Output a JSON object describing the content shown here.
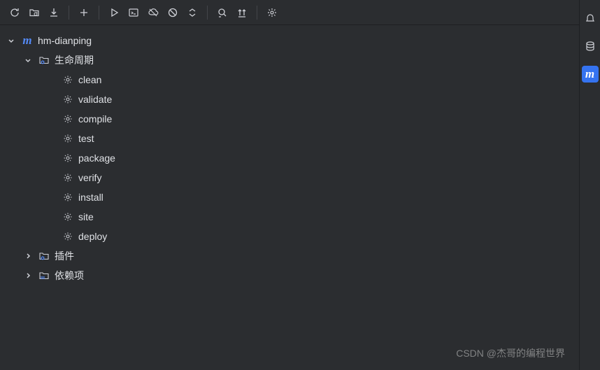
{
  "toolbar": {
    "icons": [
      "refresh",
      "add-maven",
      "download",
      "plus",
      "run",
      "run-config",
      "offline",
      "skip-tests",
      "collapse",
      "find",
      "expand-all",
      "settings"
    ]
  },
  "tree": {
    "project": {
      "label": "hm-dianping",
      "lifecycle": {
        "label": "生命周期",
        "goals": [
          "clean",
          "validate",
          "compile",
          "test",
          "package",
          "verify",
          "install",
          "site",
          "deploy"
        ]
      },
      "plugins": {
        "label": "插件"
      },
      "dependencies": {
        "label": "依赖项"
      }
    }
  },
  "watermark": "CSDN @杰哥的编程世界"
}
